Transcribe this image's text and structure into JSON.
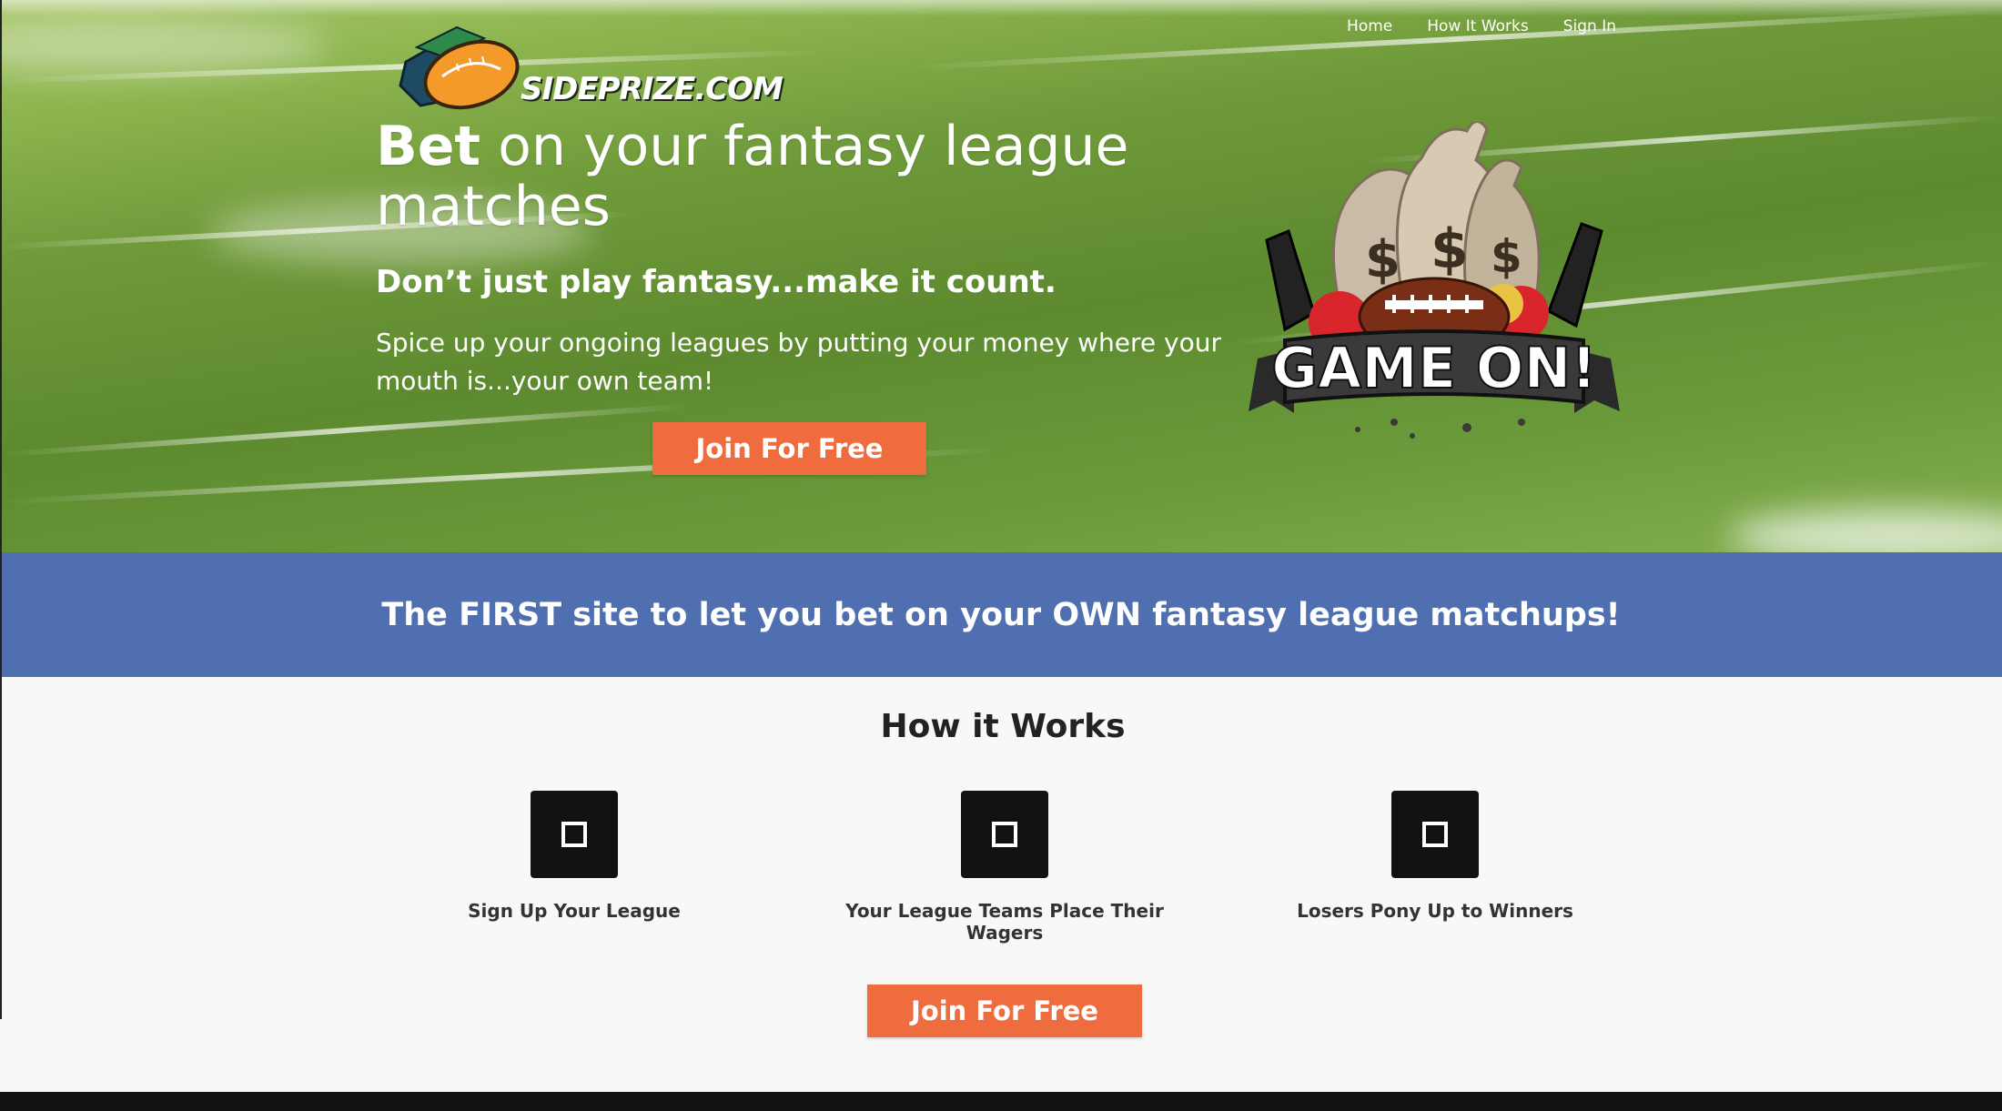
{
  "nav": {
    "items": [
      "Home",
      "How It Works",
      "Sign In"
    ]
  },
  "brand": {
    "logo_text": "SIDEPRIZE.COM"
  },
  "hero": {
    "title_bold": "Bet",
    "title_rest": " on your fantasy league matches",
    "subtitle": "Don’t just play fantasy...make it count.",
    "description": "Spice up your ongoing leagues by putting your money where your mouth is...your own team!",
    "cta_label": "Join For Free",
    "badge_text": "GAME ON!"
  },
  "banner": {
    "text": "The FIRST site to let you bet on your OWN fantasy league matchups!"
  },
  "how_it_works": {
    "title": "How it Works",
    "steps": [
      {
        "label": "Sign Up Your League",
        "icon": "square-icon"
      },
      {
        "label": "Your League Teams Place Their Wagers",
        "icon": "square-icon"
      },
      {
        "label": "Losers Pony Up to Winners",
        "icon": "square-icon"
      }
    ],
    "cta_label": "Join For Free"
  },
  "colors": {
    "accent_orange": "#ef6c3e",
    "banner_blue": "#4f6fb0",
    "field_green": "#6f9a3a",
    "icon_black": "#111111"
  }
}
